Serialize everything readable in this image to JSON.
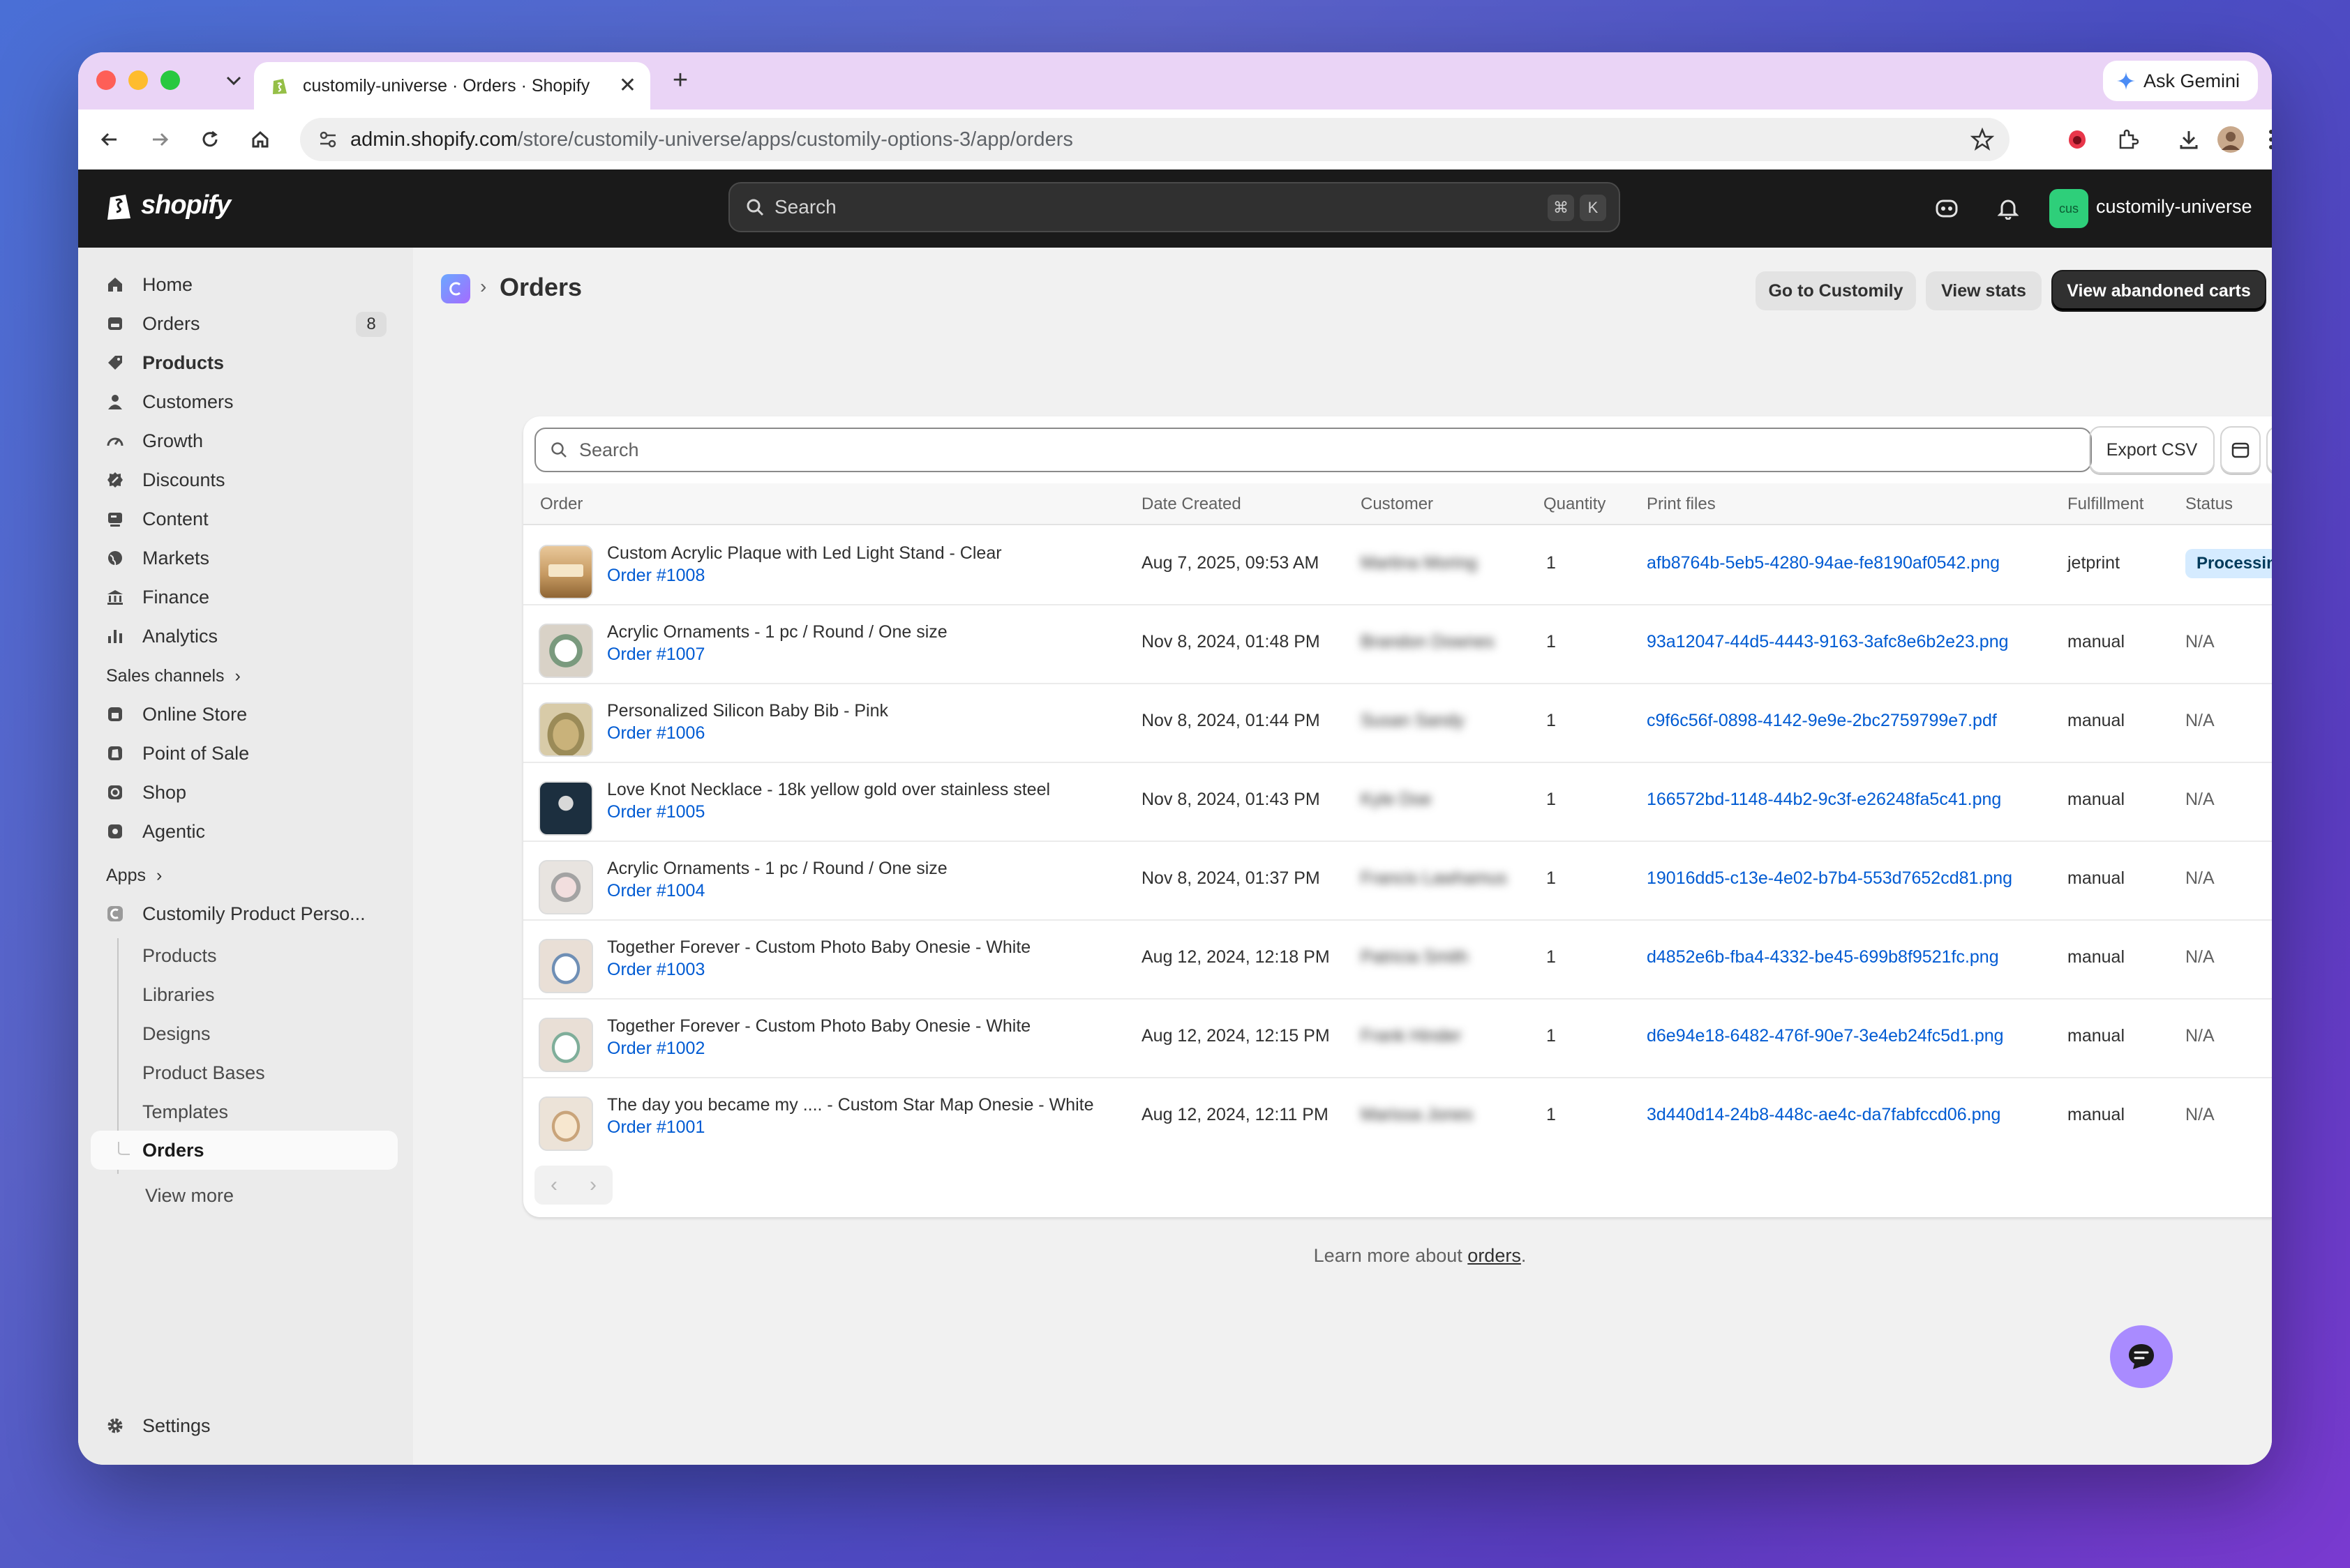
{
  "browser": {
    "tab_title": "customily-universe · Orders · Shopify",
    "ask_gemini": "Ask Gemini",
    "url_host": "admin.shopify.com",
    "url_path": "/store/customily-universe/apps/customily-options-3/app/orders"
  },
  "topbar": {
    "logo_text": "shopify",
    "search_placeholder": "Search",
    "shortcut_cmd": "⌘",
    "shortcut_key": "K",
    "store_initials": "cus",
    "store_name": "customily-universe"
  },
  "sidebar": {
    "items": [
      {
        "label": "Home",
        "icon": "home-icon"
      },
      {
        "label": "Orders",
        "icon": "orders-icon",
        "badge": "8"
      },
      {
        "label": "Products",
        "icon": "tag-icon"
      },
      {
        "label": "Customers",
        "icon": "person-icon"
      },
      {
        "label": "Growth",
        "icon": "gauge-icon"
      },
      {
        "label": "Discounts",
        "icon": "discount-icon"
      },
      {
        "label": "Content",
        "icon": "content-icon"
      },
      {
        "label": "Markets",
        "icon": "globe-icon"
      },
      {
        "label": "Finance",
        "icon": "bank-icon"
      },
      {
        "label": "Analytics",
        "icon": "bar-chart-icon"
      }
    ],
    "sales_channels_label": "Sales channels",
    "channels": [
      {
        "label": "Online Store",
        "icon": "store-icon"
      },
      {
        "label": "Point of Sale",
        "icon": "pos-icon"
      },
      {
        "label": "Shop",
        "icon": "shop-icon"
      },
      {
        "label": "Agentic",
        "icon": "agentic-icon"
      }
    ],
    "apps_label": "Apps",
    "app_name": "Customily Product Perso...",
    "app_subitems": [
      "Products",
      "Libraries",
      "Designs",
      "Product Bases",
      "Templates",
      "Orders"
    ],
    "view_more": "View more",
    "settings": "Settings"
  },
  "header": {
    "title": "Orders",
    "buttons": {
      "go_to": "Go to Customily",
      "view_stats": "View stats",
      "abandoned": "View abandoned carts"
    }
  },
  "table": {
    "search_placeholder": "Search",
    "export": "Export CSV",
    "columns": [
      "Order",
      "Date Created",
      "Customer",
      "Quantity",
      "Print files",
      "Fulfillment",
      "Status"
    ],
    "rows": [
      {
        "product": "Custom Acrylic Plaque with Led Light Stand - Clear",
        "order": "Order #1008",
        "date": "Aug 7, 2025, 09:53 AM",
        "customer": "Martina Moring",
        "qty": "1",
        "file": "afb8764b-5eb5-4280-94ae-fe8190af0542.png",
        "fulfillment": "jetprint",
        "status": "Processing"
      },
      {
        "product": "Acrylic Ornaments - 1 pc / Round / One size",
        "order": "Order #1007",
        "date": "Nov 8, 2024, 01:48 PM",
        "customer": "Brandon Downes",
        "qty": "1",
        "file": "93a12047-44d5-4443-9163-3afc8e6b2e23.png",
        "fulfillment": "manual",
        "status": "N/A"
      },
      {
        "product": "Personalized Silicon Baby Bib - Pink",
        "order": "Order #1006",
        "date": "Nov 8, 2024, 01:44 PM",
        "customer": "Susan Sandy",
        "qty": "1",
        "file": "c9f6c56f-0898-4142-9e9e-2bc2759799e7.pdf",
        "fulfillment": "manual",
        "status": "N/A"
      },
      {
        "product": "Love Knot Necklace - 18k yellow gold over stainless steel",
        "order": "Order #1005",
        "date": "Nov 8, 2024, 01:43 PM",
        "customer": "Kyle Doe",
        "qty": "1",
        "file": "166572bd-1148-44b2-9c3f-e26248fa5c41.png",
        "fulfillment": "manual",
        "status": "N/A"
      },
      {
        "product": "Acrylic Ornaments - 1 pc / Round / One size",
        "order": "Order #1004",
        "date": "Nov 8, 2024, 01:37 PM",
        "customer": "Francis Lawhamus",
        "qty": "1",
        "file": "19016dd5-c13e-4e02-b7b4-553d7652cd81.png",
        "fulfillment": "manual",
        "status": "N/A"
      },
      {
        "product": "Together Forever - Custom Photo Baby Onesie - White",
        "order": "Order #1003",
        "date": "Aug 12, 2024, 12:18 PM",
        "customer": "Patricia Smith",
        "qty": "1",
        "file": "d4852e6b-fba4-4332-be45-699b8f9521fc.png",
        "fulfillment": "manual",
        "status": "N/A"
      },
      {
        "product": "Together Forever - Custom Photo Baby Onesie - White",
        "order": "Order #1002",
        "date": "Aug 12, 2024, 12:15 PM",
        "customer": "Frank Hinder",
        "qty": "1",
        "file": "d6e94e18-6482-476f-90e7-3e4eb24fc5d1.png",
        "fulfillment": "manual",
        "status": "N/A"
      },
      {
        "product": "The day you became my .... - Custom Star Map Onesie - White",
        "order": "Order #1001",
        "date": "Aug 12, 2024, 12:11 PM",
        "customer": "Marissa Jones",
        "qty": "1",
        "file": "3d440d14-24b8-448c-ae4c-da7fabfccd06.png",
        "fulfillment": "manual",
        "status": "N/A"
      }
    ]
  },
  "footer": {
    "learn_prefix": "Learn more about ",
    "learn_link": "orders",
    "learn_suffix": "."
  },
  "colors": {
    "link": "#005bd3",
    "processing_bg": "#d5ebff",
    "topbar": "#1a1a1a",
    "tabstrip": "#ead4f6"
  }
}
